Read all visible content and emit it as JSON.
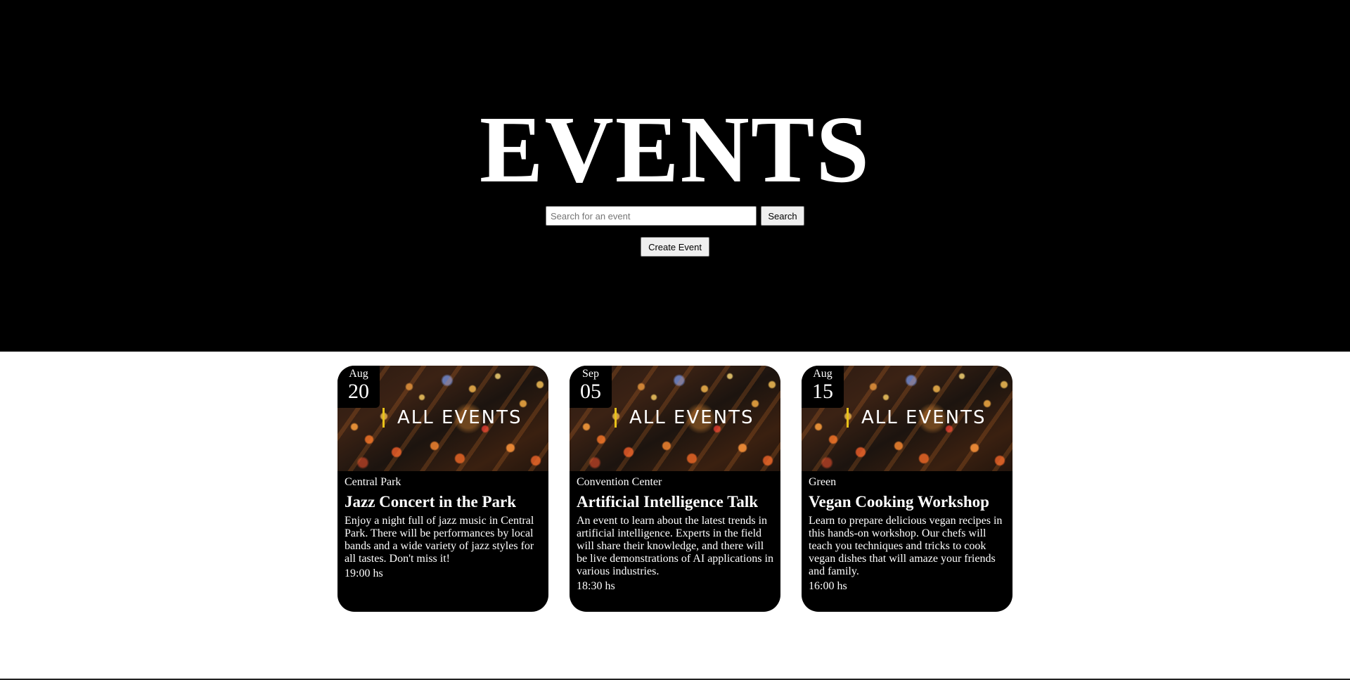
{
  "header": {
    "title": "EVENTS",
    "search_placeholder": "Search for an event",
    "search_value": "",
    "search_label": "Search",
    "create_label": "Create Event"
  },
  "events": [
    {
      "month": "Aug",
      "day": "20",
      "image_text": "ALL EVENTS",
      "location": "Central Park",
      "title": "Jazz Concert in the Park",
      "description": "Enjoy a night full of jazz music in Central Park. There will be performances by local bands and a wide variety of jazz styles for all tastes. Don't miss it!",
      "time": "19:00 hs"
    },
    {
      "month": "Sep",
      "day": "05",
      "image_text": "ALL EVENTS",
      "location": "Convention Center",
      "title": "Artificial Intelligence Talk",
      "description": "An event to learn about the latest trends in artificial intelligence. Experts in the field will share their knowledge, and there will be live demonstrations of AI applications in various industries.",
      "time": "18:30 hs"
    },
    {
      "month": "Aug",
      "day": "15",
      "image_text": "ALL EVENTS",
      "location": "Green",
      "title": "Vegan Cooking Workshop",
      "description": "Learn to prepare delicious vegan recipes in this hands-on workshop. Our chefs will teach you techniques and tricks to cook vegan dishes that will amaze your friends and family.",
      "time": "16:00 hs"
    }
  ],
  "colors": {
    "hero_background": "#000000",
    "card_background": "#000000",
    "accent_bar": "#e8c21a",
    "text": "#ffffff"
  }
}
